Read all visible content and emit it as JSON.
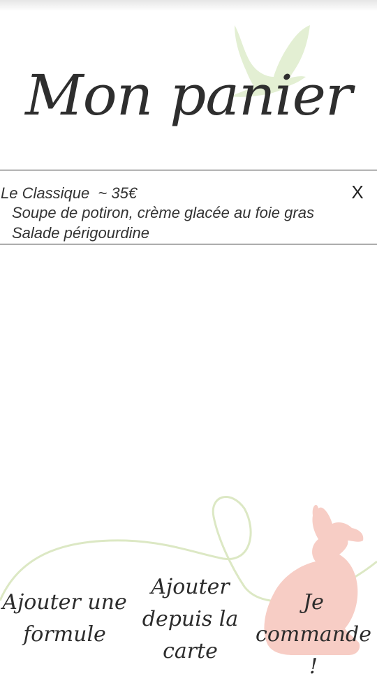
{
  "header": {
    "title": "Mon panier"
  },
  "cart": {
    "items": [
      {
        "name": "Le Classique  ~ 35€",
        "lines": [
          "Soupe de potiron, crème glacée au foie gras",
          "Salade périgourdine"
        ],
        "remove_label": "X"
      }
    ]
  },
  "actions": {
    "add_formule": "Ajouter une formule",
    "add_carte": "Ajouter depuis la carte",
    "order": "Je commande !"
  },
  "colors": {
    "dove": "#e3efd3",
    "rabbit": "#f7cdc5",
    "ribbon": "#dce8c4",
    "text": "#2f2f2f"
  }
}
